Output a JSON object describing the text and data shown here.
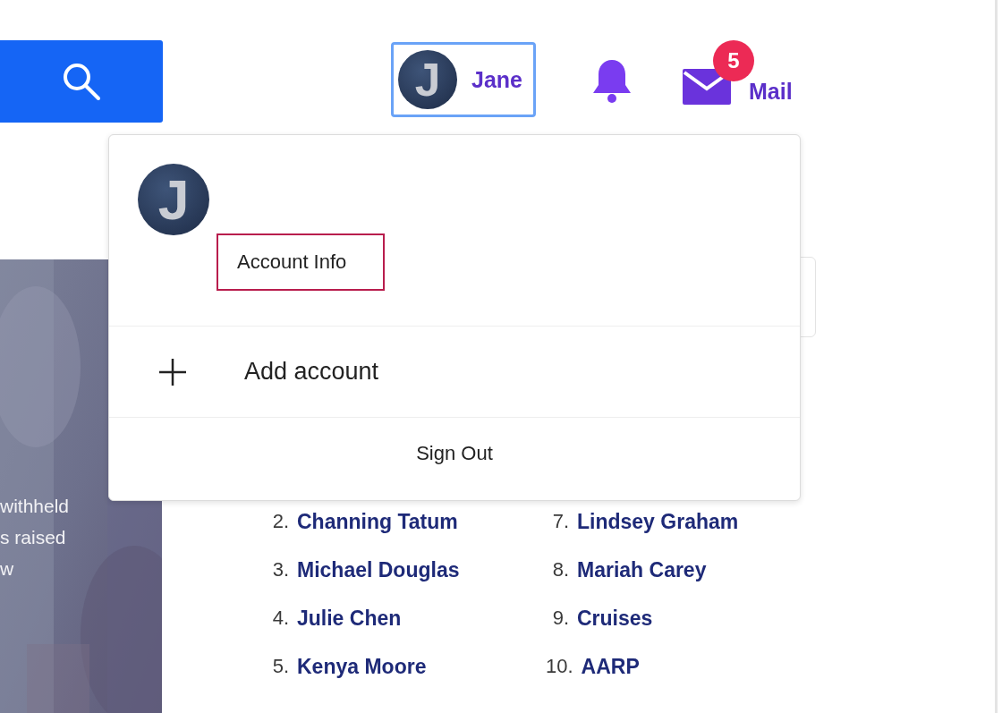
{
  "header": {
    "search_button": {
      "kind": "search"
    },
    "user": {
      "initial": "J",
      "name": "Jane",
      "focused": true
    },
    "mail": {
      "badge": "5",
      "label": "Mail"
    }
  },
  "story": {
    "kind": "picture",
    "lines": [
      "withheld",
      "s raised",
      "w"
    ]
  },
  "account_menu": {
    "initial": "J",
    "account_info": "Account Info",
    "account_info_highlighted": true,
    "add_account": "Add account",
    "sign_out": "Sign Out"
  },
  "trending": [
    {
      "rank": "2.",
      "name": "Channing Tatum"
    },
    {
      "rank": "3.",
      "name": "Michael Douglas"
    },
    {
      "rank": "4.",
      "name": "Julie Chen"
    },
    {
      "rank": "5.",
      "name": "Kenya Moore"
    },
    {
      "rank": "7.",
      "name": "Lindsey Graham"
    },
    {
      "rank": "8.",
      "name": "Mariah Carey"
    },
    {
      "rank": "9.",
      "name": "Cruises"
    },
    {
      "rank": "10.",
      "name": "AARP"
    }
  ]
}
